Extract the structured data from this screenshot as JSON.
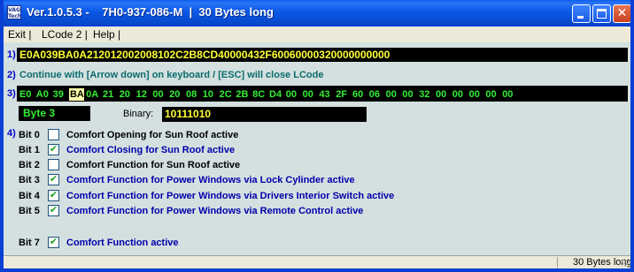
{
  "window": {
    "title": "Ver.1.0.5.3 -    7H0-937-086-M  |  30 Bytes long",
    "icon_text": "VAG Tech",
    "controls": [
      "minimize-icon",
      "maximize-icon",
      "close-icon"
    ]
  },
  "menu": {
    "items": [
      "Exit |",
      "LCode 2 |",
      "Help |"
    ]
  },
  "section_labels": [
    "1)",
    "2)",
    "3)",
    "4)"
  ],
  "lcode": "E0A039BA0A212012002008102C2B8CD40000432F60060000320000000000",
  "hint": "Continue with [Arrow down] on keyboard / [ESC] will close LCode",
  "bytes": [
    "E0",
    "A0",
    "39",
    "BA",
    "0A",
    "21",
    "20",
    "12",
    "00",
    "20",
    "08",
    "10",
    "2C",
    "2B",
    "8C",
    "D4",
    "00",
    "00",
    "43",
    "2F",
    "60",
    "06",
    "00",
    "00",
    "32",
    "00",
    "00",
    "00",
    "00",
    "00"
  ],
  "selected_byte_index": 3,
  "byte_label": "Byte 3",
  "binary": {
    "label": "Binary:",
    "value": "10111010"
  },
  "bits": [
    {
      "bit": "Bit 0",
      "checked": false,
      "text": "Comfort Opening for Sun Roof active"
    },
    {
      "bit": "Bit 1",
      "checked": true,
      "text": "Comfort Closing for Sun Roof active"
    },
    {
      "bit": "Bit 2",
      "checked": false,
      "text": "Comfort Function for Sun Roof active"
    },
    {
      "bit": "Bit 3",
      "checked": true,
      "text": "Comfort Function for Power Windows via Lock Cylinder active"
    },
    {
      "bit": "Bit 4",
      "checked": true,
      "text": "Comfort Function for Power Windows via Drivers Interior Switch active"
    },
    {
      "bit": "Bit 5",
      "checked": true,
      "text": "Comfort Function for Power Windows via Remote Control active"
    },
    {
      "bit": "Bit 7",
      "checked": true,
      "text": "Comfort Function active"
    }
  ],
  "status": {
    "text": "30 Bytes long"
  },
  "colors": {
    "titlebar": "#0a58e6",
    "lcode_text": "#ffff33",
    "byte_text": "#33ee33",
    "checked_text": "#0000aa",
    "hint_text": "#0b6b6b",
    "client_bg": "#d4e0e0"
  }
}
